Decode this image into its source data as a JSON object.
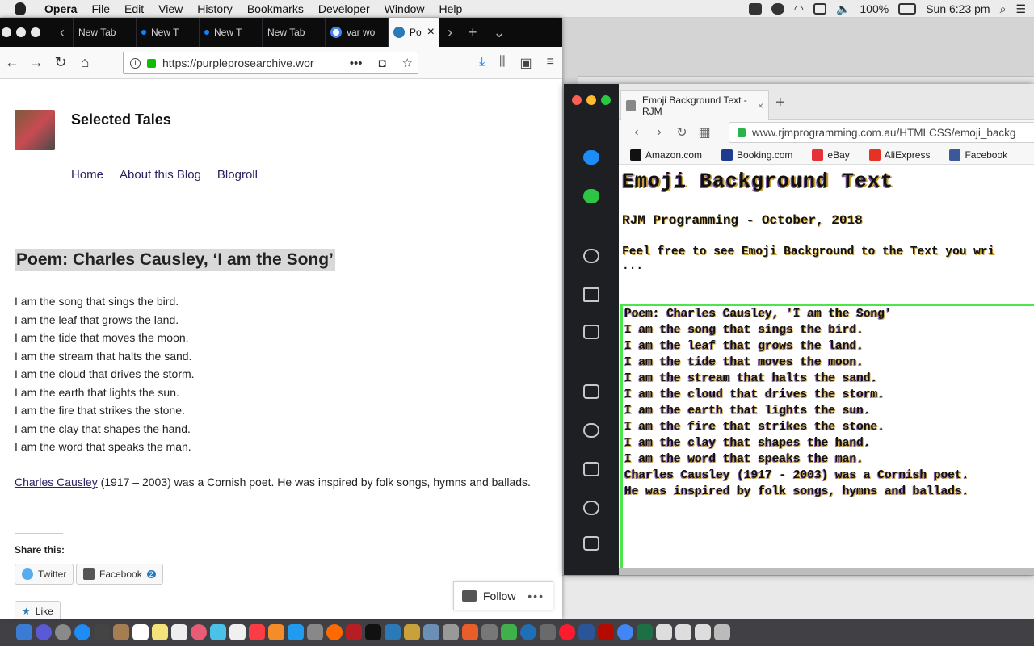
{
  "menubar": {
    "app": "Opera",
    "items": [
      "File",
      "Edit",
      "View",
      "History",
      "Bookmarks",
      "Developer",
      "Window",
      "Help"
    ],
    "battery": "100%",
    "clock": "Sun 6:23 pm"
  },
  "firefox": {
    "tabs": [
      "New Tab",
      "New T",
      "New T",
      "New Tab",
      "var wo",
      "Po"
    ],
    "url": "https://purpleprosearchive.wor",
    "page": {
      "site_title": "Selected Tales",
      "nav": [
        "Home",
        "About this Blog",
        "Blogroll"
      ],
      "post_title": "Poem: Charles Causley, ‘I am the Song’",
      "poem": [
        "I am the song that sings the bird.",
        "I am the leaf that grows the land.",
        "I am the tide that moves the moon.",
        "I am the stream that halts the sand.",
        "I am the cloud that drives the storm.",
        "I am the earth that lights the sun.",
        "I am the fire that strikes the stone.",
        "I am the clay that shapes the hand.",
        "I am the word that speaks the man."
      ],
      "bio_link": "Charles Causley",
      "bio_text": " (1917 – 2003) was a Cornish poet.  He was inspired by folk songs, hymns and ballads.",
      "share_title": "Share this:",
      "share_twitter": "Twitter",
      "share_facebook": "Facebook",
      "facebook_count": "2",
      "like": "Like",
      "follow": "Follow"
    }
  },
  "opera": {
    "tab_title": "Emoji Background Text - RJM",
    "url": "www.rjmprogramming.com.au/HTMLCSS/emoji_backg",
    "bookmarks": [
      {
        "label": "Amazon.com",
        "color": "#111111"
      },
      {
        "label": "Booking.com",
        "color": "#1f3b8f"
      },
      {
        "label": "eBay",
        "color": "#e53238"
      },
      {
        "label": "AliExpress",
        "color": "#e43225"
      },
      {
        "label": "Facebook",
        "color": "#3b5998"
      }
    ],
    "content": {
      "h1": "Emoji Background Text",
      "h3": "RJM Programming - October, 2018",
      "intro": "Feel free to see Emoji Background to the Text you wri",
      "dots": "...",
      "box_lines": [
        "Poem: Charles Causley, 'I am the Song'",
        "",
        "I am the song that sings the bird.",
        "I am the leaf that grows the land.",
        "I am the tide that moves the moon.",
        "I am the stream that halts the sand.",
        "I am the cloud that drives the storm.",
        "I am the earth that lights the sun.",
        "I am the fire that strikes the stone.",
        "I am the clay that shapes the hand.",
        "I am the word that speaks the man.",
        "",
        "",
        "Charles Causley (1917 - 2003) was a Cornish poet.",
        "He was inspired by folk songs, hymns and ballads."
      ]
    }
  }
}
